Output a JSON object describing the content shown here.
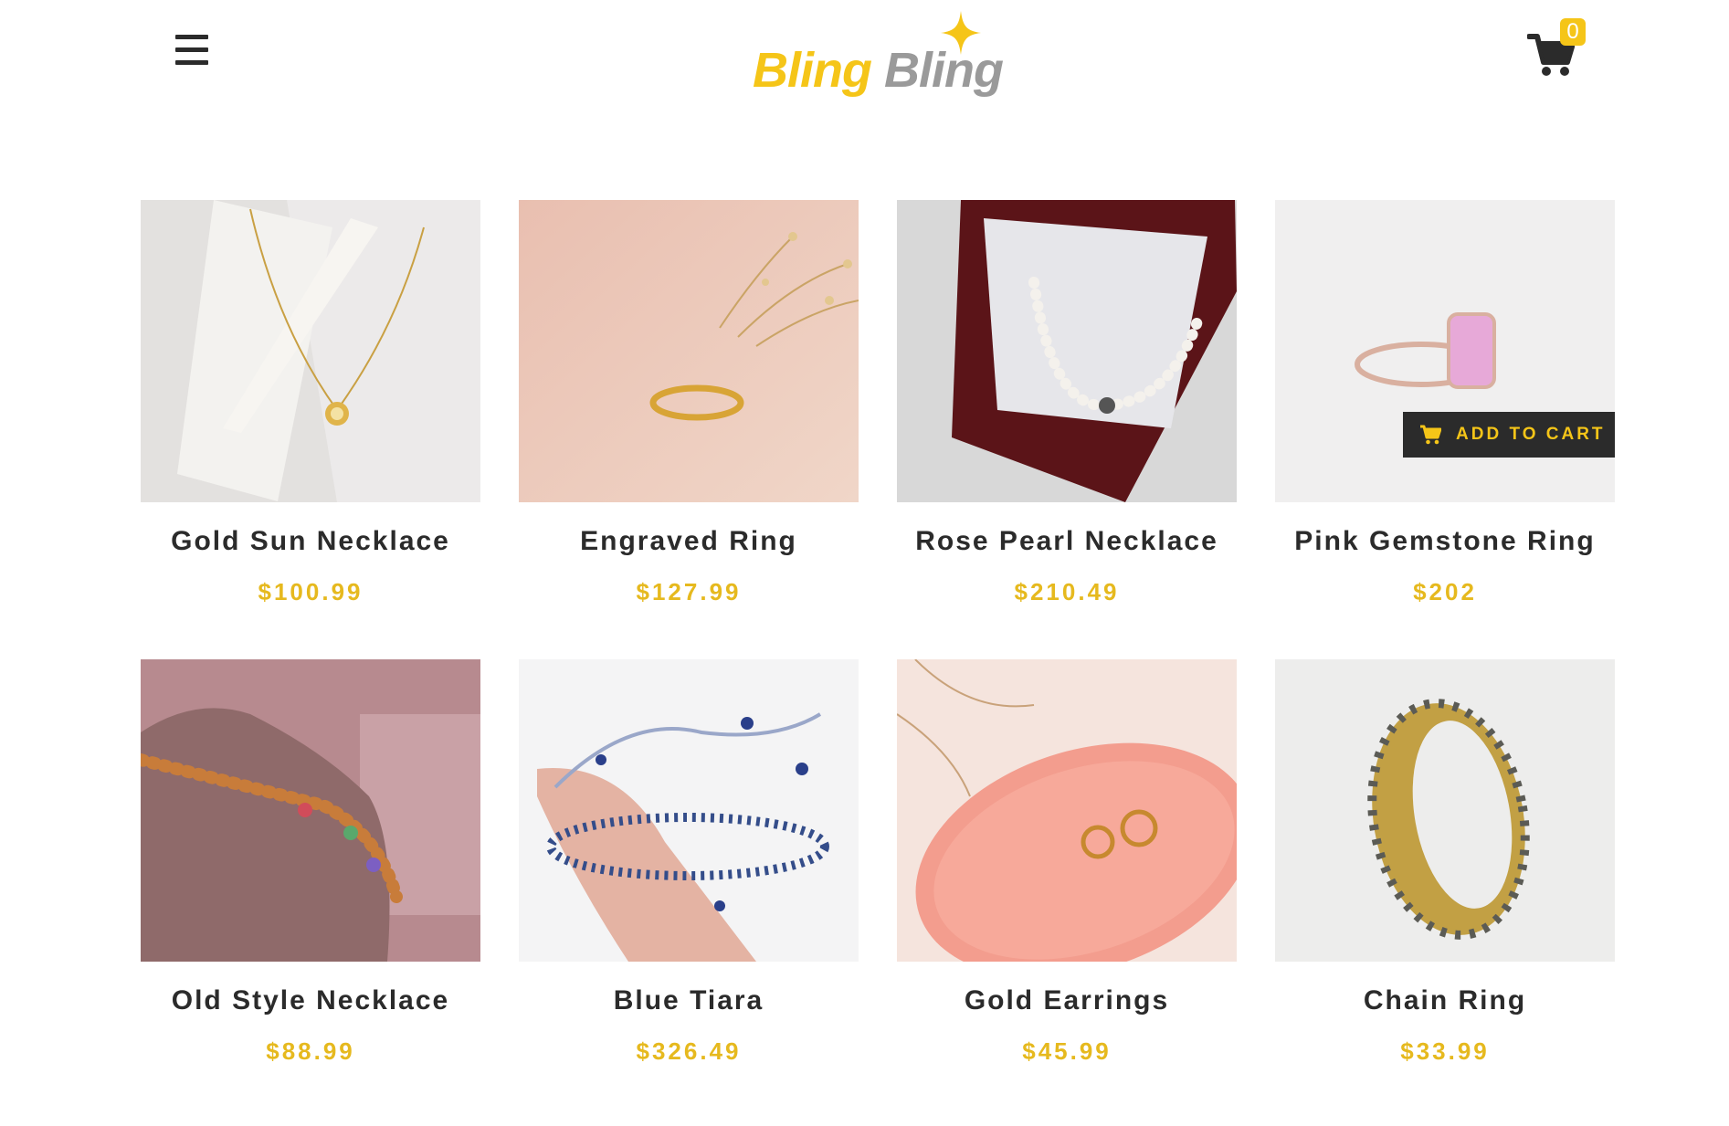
{
  "header": {
    "logo_word1": "Bling",
    "logo_word2": "Bling",
    "cart_count": "0",
    "menu_icon": "hamburger-menu-icon",
    "cart_icon": "shopping-cart-icon"
  },
  "add_to_cart_label": "ADD TO CART",
  "colors": {
    "accent": "#f5c518",
    "price": "#e6b91e",
    "text": "#2b2b2b",
    "button_bg": "#2b2b2b"
  },
  "products": [
    {
      "name": "Gold Sun Necklace",
      "price": "$100.99"
    },
    {
      "name": "Engraved Ring",
      "price": "$127.99"
    },
    {
      "name": "Rose Pearl Necklace",
      "price": "$210.49"
    },
    {
      "name": "Pink Gemstone Ring",
      "price": "$202"
    },
    {
      "name": "Old Style Necklace",
      "price": "$88.99"
    },
    {
      "name": "Blue Tiara",
      "price": "$326.49"
    },
    {
      "name": "Gold Earrings",
      "price": "$45.99"
    },
    {
      "name": "Chain Ring",
      "price": "$33.99"
    }
  ]
}
